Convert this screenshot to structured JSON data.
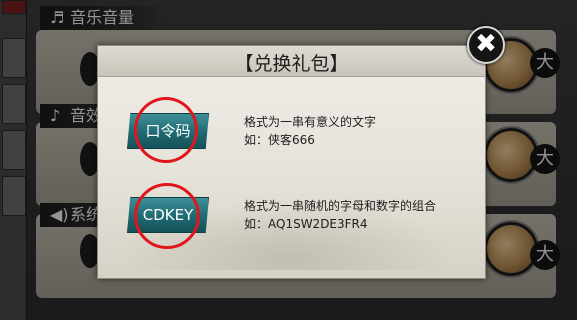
{
  "background": {
    "sections": [
      {
        "label": "音乐音量",
        "icon": "music-note-icon",
        "glyph": "♬"
      },
      {
        "label": "音效",
        "icon": "music-note-icon",
        "glyph": "♪"
      },
      {
        "label": "系统",
        "icon": "speaker-icon",
        "glyph": "◀)"
      }
    ],
    "max_label": "大"
  },
  "dialog": {
    "title": "【兑换礼包】",
    "close_icon": "close-x-icon",
    "close_glyph": "✖",
    "options": [
      {
        "button_label": "口令码",
        "description": "格式为一串有意义的文字",
        "example": "如：侠客666"
      },
      {
        "button_label": "CDKEY",
        "description": "格式为一串随机的字母和数字的组合",
        "example": "如：AQ1SW2DE3FR4"
      }
    ]
  },
  "colors": {
    "button_teal": "#1f6a73",
    "highlight_red": "#e0161c",
    "dialog_bg": "#ebe8e1"
  }
}
